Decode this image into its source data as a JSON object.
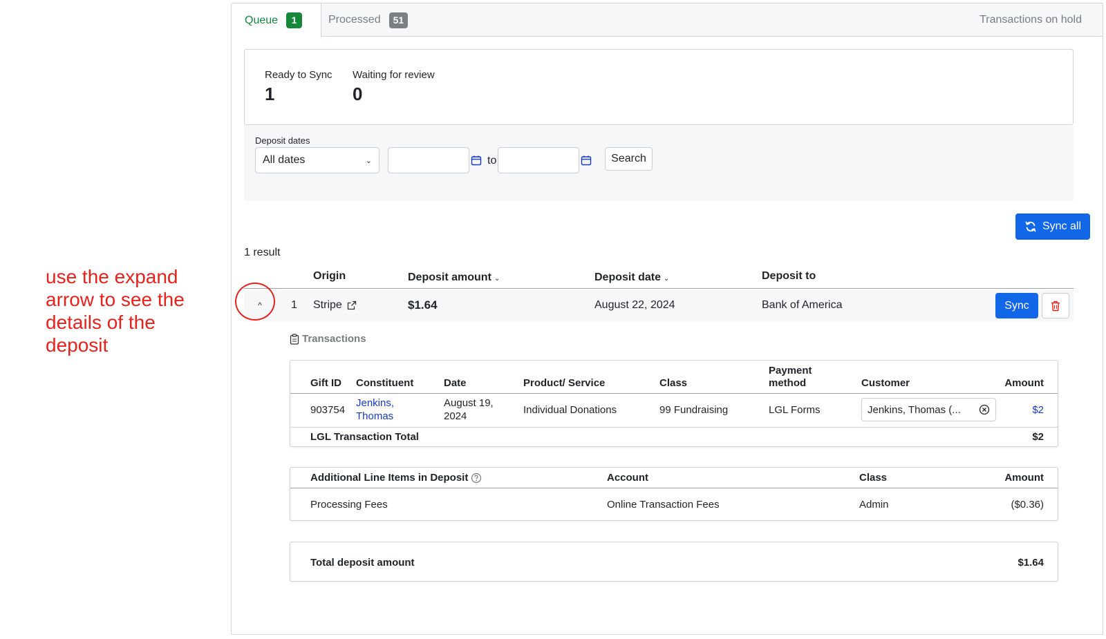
{
  "annotation": "use the expand arrow to see the details of the deposit",
  "tabs": {
    "queue_label": "Queue",
    "queue_count": "1",
    "processed_label": "Processed",
    "processed_count": "51",
    "hold_label": "Transactions on hold"
  },
  "summary": {
    "ready_label": "Ready to Sync",
    "ready_value": "1",
    "waiting_label": "Waiting for review",
    "waiting_value": "0"
  },
  "filters": {
    "label": "Deposit dates",
    "select_value": "All dates",
    "from_value": "",
    "to_label": "to",
    "to_value": "",
    "search_label": "Search"
  },
  "sync_all_label": "Sync all",
  "result_count": "1 result",
  "deposit_columns": {
    "origin": "Origin",
    "amount": "Deposit amount",
    "date": "Deposit date",
    "to": "Deposit to"
  },
  "deposit": {
    "index": "1",
    "origin": "Stripe",
    "amount": "$1.64",
    "date": "August 22, 2024",
    "to": "Bank of America",
    "sync_label": "Sync"
  },
  "transactions": {
    "title": "Transactions",
    "columns": {
      "gift_id": "Gift ID",
      "constituent": "Constituent",
      "date": "Date",
      "product": "Product/ Service",
      "class": "Class",
      "payment_1": "Payment",
      "payment_2": "method",
      "customer": "Customer",
      "amount": "Amount"
    },
    "rows": [
      {
        "gift_id": "903754",
        "constituent_1": "Jenkins,",
        "constituent_2": "Thomas",
        "date_1": "August 19,",
        "date_2": "2024",
        "product": "Individual Donations",
        "class": "99 Fundraising",
        "payment": "LGL Forms",
        "customer": "Jenkins, Thomas (...",
        "amount": "$2"
      }
    ],
    "total_label": "LGL Transaction Total",
    "total_value": "$2"
  },
  "additional": {
    "title": "Additional Line Items in Deposit",
    "account_h": "Account",
    "class_h": "Class",
    "amount_h": "Amount",
    "rows": [
      {
        "item": "Processing Fees",
        "account": "Online Transaction Fees",
        "class": "Admin",
        "amount": "($0.36)"
      }
    ]
  },
  "total": {
    "label": "Total deposit amount",
    "value": "$1.64"
  },
  "colors": {
    "primary": "#1267e8",
    "success": "#16883a",
    "annotation": "#e8221b",
    "link": "#1538c9"
  }
}
